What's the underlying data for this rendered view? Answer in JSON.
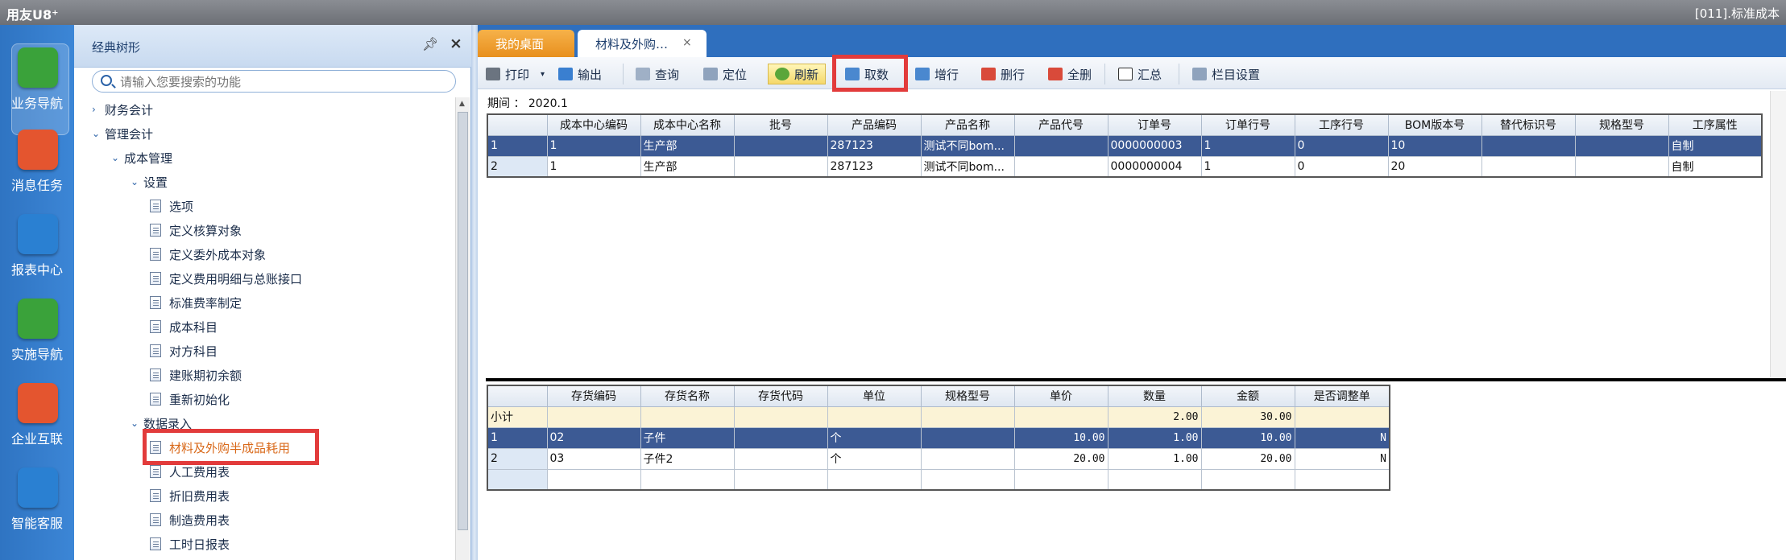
{
  "titlebar": {
    "brand": "用友U8⁺",
    "right_text": "[011].标准成本"
  },
  "rail": {
    "items": [
      {
        "label": "业务导航",
        "icon": "business-nav-icon",
        "color": "#3aa23a"
      },
      {
        "label": "消息任务",
        "icon": "message-task-icon",
        "color": "#e4552f"
      },
      {
        "label": "报表中心",
        "icon": "report-center-icon",
        "color": "#2a80d2"
      },
      {
        "label": "实施导航",
        "icon": "implementation-nav-icon",
        "color": "#3aa23a"
      },
      {
        "label": "企业互联",
        "icon": "enterprise-connect-icon",
        "color": "#e4552f"
      },
      {
        "label": "智能客服",
        "icon": "smart-service-icon",
        "color": "#2a80d2"
      }
    ]
  },
  "tree": {
    "title": "经典树形",
    "search_placeholder": "请输入您要搜索的功能",
    "nodes": [
      {
        "label": "财务会计",
        "chev": "›"
      },
      {
        "label": "管理会计",
        "chev": "⌄"
      },
      {
        "label": "成本管理",
        "chev": "⌄"
      },
      {
        "label": "设置",
        "chev": "⌄"
      },
      {
        "label": "选项"
      },
      {
        "label": "定义核算对象"
      },
      {
        "label": "定义委外成本对象"
      },
      {
        "label": "定义费用明细与总账接口"
      },
      {
        "label": "标准费率制定"
      },
      {
        "label": "成本科目"
      },
      {
        "label": "对方科目"
      },
      {
        "label": "建账期初余额"
      },
      {
        "label": "重新初始化"
      },
      {
        "label": "数据录入",
        "chev": "⌄"
      },
      {
        "label": "材料及外购半成品耗用"
      },
      {
        "label": "人工费用表"
      },
      {
        "label": "折旧费用表"
      },
      {
        "label": "制造费用表"
      },
      {
        "label": "工时日报表"
      }
    ]
  },
  "tabs": {
    "home": "我的桌面",
    "active": "材料及外购…",
    "close": "×"
  },
  "toolbar": {
    "print": "打印",
    "export": "输出",
    "query": "查询",
    "locate": "定位",
    "refresh": "刷新",
    "fetch": "取数",
    "add_row": "增行",
    "delete_row": "删行",
    "delete_all": "全删",
    "summary": "汇总",
    "column_settings": "栏目设置"
  },
  "period": {
    "label": "期间 ： 2020.1"
  },
  "grid1": {
    "headers": [
      "",
      "成本中心编码",
      "成本中心名称",
      "批号",
      "产品编码",
      "产品名称",
      "产品代号",
      "订单号",
      "订单行号",
      "工序行号",
      "BOM版本号",
      "替代标识号",
      "规格型号",
      "工序属性"
    ],
    "rows": [
      [
        "1",
        "1",
        "生产部",
        "",
        "287123",
        "测试不同bom...",
        "",
        "0000000003",
        "1",
        "0",
        "10",
        "",
        "",
        "自制"
      ],
      [
        "2",
        "1",
        "生产部",
        "",
        "287123",
        "测试不同bom...",
        "",
        "0000000004",
        "1",
        "0",
        "20",
        "",
        "",
        "自制"
      ]
    ]
  },
  "grid2": {
    "headers": [
      "",
      "存货编码",
      "存货名称",
      "存货代码",
      "单位",
      "规格型号",
      "单价",
      "数量",
      "金额",
      "是否调整单"
    ],
    "subtotal": [
      "小计",
      "",
      "",
      "",
      "",
      "",
      "",
      "2.00",
      "30.00",
      ""
    ],
    "rows": [
      [
        "1",
        "02",
        "子件",
        "",
        "个",
        "",
        "10.00",
        "1.00",
        "10.00",
        "N"
      ],
      [
        "2",
        "03",
        "子件2",
        "",
        "个",
        "",
        "20.00",
        "1.00",
        "20.00",
        "N"
      ],
      [
        "",
        "",
        "",
        "",
        "",
        "",
        "",
        "",
        "",
        ""
      ]
    ]
  },
  "colors": {
    "accent": "#2f6fbe",
    "highlight": "#e23b3b",
    "selected_row": "#3c5a94",
    "active_tree_item": "#d9691a"
  }
}
